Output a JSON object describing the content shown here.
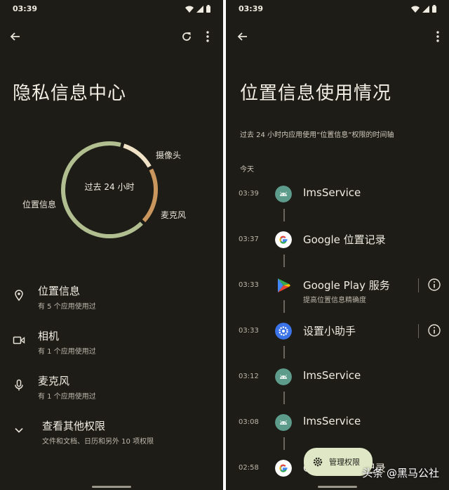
{
  "left": {
    "status_time": "03:39",
    "title": "隐私信息中心",
    "ring": {
      "center_label": "过去 24 小时",
      "label_camera": "摄像头",
      "label_mic": "麦克风",
      "label_location": "位置信息",
      "color_location": "#b1be8f",
      "color_camera": "#efe2c6",
      "color_mic": "#c9965d"
    },
    "permissions": [
      {
        "title": "位置信息",
        "subtitle": "有 5 个应用使用过",
        "icon": "location-pin-icon"
      },
      {
        "title": "相机",
        "subtitle": "有 1 个应用使用过",
        "icon": "camera-icon"
      },
      {
        "title": "麦克风",
        "subtitle": "有 1 个应用使用过",
        "icon": "microphone-icon"
      },
      {
        "title": "查看其他权限",
        "subtitle": "文件和文档、日历和另外 10 项权限",
        "icon": "chevron-down-icon"
      }
    ]
  },
  "right": {
    "status_time": "03:39",
    "title": "位置信息使用情况",
    "subtitle": "过去 24 小时内应用使用“位置信息”权限的时间轴",
    "section": "今天",
    "timeline": [
      {
        "time": "03:39",
        "name": "ImsService",
        "icon": "android-icon",
        "sub": ""
      },
      {
        "time": "03:37",
        "name": "Google 位置记录",
        "icon": "google-icon",
        "sub": ""
      },
      {
        "time": "03:33",
        "name": "Google Play 服务",
        "icon": "play-services-icon",
        "sub": "提高位置信息精确度"
      },
      {
        "time": "03:33",
        "name": "设置小助手",
        "icon": "settings-gear-app-icon",
        "sub": ""
      },
      {
        "time": "03:12",
        "name": "ImsService",
        "icon": "android-icon",
        "sub": ""
      },
      {
        "time": "03:08",
        "name": "ImsService",
        "icon": "android-icon",
        "sub": ""
      },
      {
        "time": "02:58",
        "name": "Google 位置记录",
        "icon": "google-icon",
        "sub": ""
      }
    ],
    "fab_label": "管理权限",
    "watermark": "头条 @黑马公社"
  }
}
